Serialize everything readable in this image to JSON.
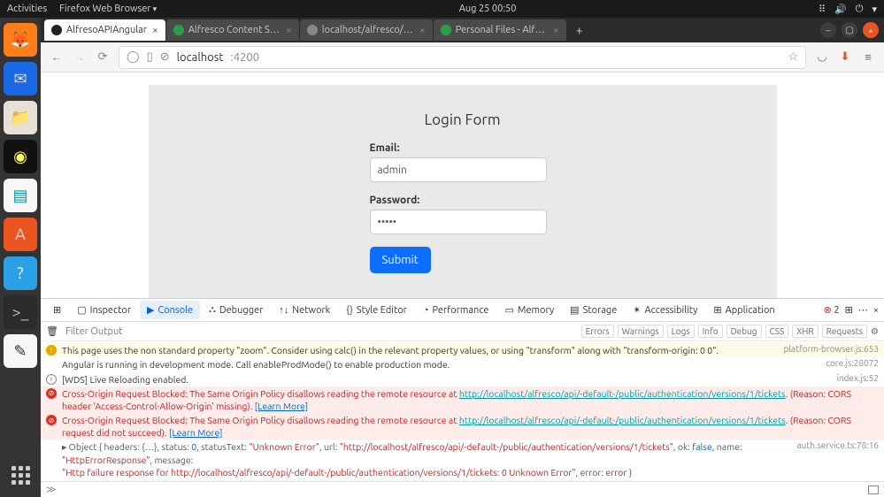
{
  "top_bar": {
    "activities": "Activities",
    "app_menu": "Firefox Web Browser",
    "clock": "Aug 25  00:50"
  },
  "tabs": {
    "items": [
      {
        "label": "AlfresoAPIAngular",
        "favicon": "#222"
      },
      {
        "label": "Alfresco Content Service",
        "favicon": "#2a9d4a"
      },
      {
        "label": "localhost/alfresco/api/-def...",
        "favicon": "#888"
      },
      {
        "label": "Personal Files - Alfresco",
        "favicon": "#2a9d4a"
      }
    ],
    "add": "+"
  },
  "url_bar": {
    "host": "localhost",
    "path": ":4200"
  },
  "login": {
    "title": "Login Form",
    "email_label": "Email:",
    "email_value": "admin",
    "password_label": "Password:",
    "password_value": "•••••",
    "submit": "Submit"
  },
  "devtools": {
    "tabs": [
      "Inspector",
      "Console",
      "Debugger",
      "Network",
      "Style Editor",
      "Performance",
      "Memory",
      "Storage",
      "Accessibility",
      "Application"
    ],
    "selected_tab": "Console",
    "error_count": "2",
    "filter_placeholder": "Filter Output",
    "categories": [
      "Errors",
      "Warnings",
      "Logs",
      "Info",
      "Debug",
      "CSS",
      "XHR",
      "Requests"
    ],
    "logs": {
      "warn1": "This page uses the non standard property \"zoom\". Consider using calc() in the relevant property values, or using \"transform\" along with \"transform-origin: 0 0\".",
      "warn1_src": "platform-browser.js:653",
      "info1": "Angular is running in development mode. Call enableProdMode() to enable production mode.",
      "info1_src": "core.js:28072",
      "info2": "[WDS] Live Reloading enabled.",
      "info2_src": "index.js:52",
      "err1_a": "Cross-Origin Request Blocked: The Same Origin Policy disallows reading the remote resource at ",
      "err1_url": "http://localhost/alfresco/api/-default-/public/authentication/versions/1/tickets",
      "err1_b": ". (Reason: CORS header 'Access-Control-Allow-Origin' missing). ",
      "learn_more": "[Learn More]",
      "err2_a": "Cross-Origin Request Blocked: The Same Origin Policy disallows reading the remote resource at ",
      "err2_url": "http://localhost/alfresco/api/-default-/public/authentication/versions/1/tickets",
      "err2_b": ". (Reason: CORS request did not succeed). ",
      "obj_prefix": "▸ Object ",
      "obj_open": "{ headers: {…}, status: ",
      "obj_status": "0",
      "obj_mid1": ", statusText: ",
      "obj_statusText": "\"Unknown Error\"",
      "obj_mid2": ", url: ",
      "obj_url": "\"http://localhost/alfresco/api/-default-/public/authentication/versions/1/tickets\"",
      "obj_mid3": ", ok: ",
      "obj_ok": "false",
      "obj_mid4": ", name: ",
      "obj_name": "\"HttpErrorResponse\"",
      "obj_mid5": ", message: ",
      "obj_line2a": "\"Http failure response for http://localhost/alfresco/api/-default-/public/authentication/versions/1/tickets: 0 Unknown Error\"",
      "obj_mid6": ", error: ",
      "obj_error": "error",
      "obj_close": " }",
      "obj_src": "auth.service.ts:78:16"
    },
    "prompt": "≫"
  }
}
